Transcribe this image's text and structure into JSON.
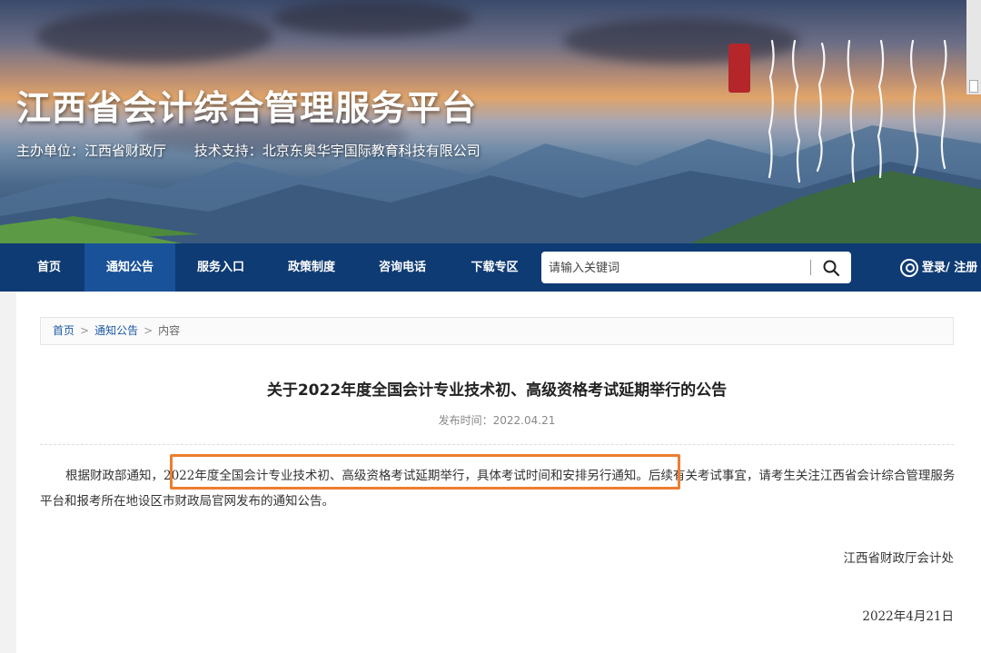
{
  "banner": {
    "title": "江西省会计综合管理服务平台",
    "host": "主办单位：江西省财政厅",
    "support": "技术支持：北京东奥华宇国际教育科技有限公司"
  },
  "nav": {
    "items": [
      {
        "label": "首页"
      },
      {
        "label": "通知公告"
      },
      {
        "label": "服务入口"
      },
      {
        "label": "政策制度"
      },
      {
        "label": "咨询电话"
      },
      {
        "label": "下载专区"
      }
    ],
    "active": "通知公告",
    "search_placeholder": "请输入关键词",
    "login_label": "登录/ 注册"
  },
  "breadcrumb": {
    "home": "首页",
    "notices": "通知公告",
    "current": "内容",
    "separator": ">"
  },
  "article": {
    "title": "关于2022年度全国会计专业技术初、高级资格考试延期举行的公告",
    "publish_time": "发布时间：2022.04.21",
    "body_lead": "根据财政部通知，",
    "body_highlight": "2022年度全国会计专业技术初、高级资格考试延期举行，具体考试时间和安排另行通知。",
    "body_rest": "后续有关考试事宜，请考生关注江西省会计综合管理服务平台和报考所在地设区市财政局官网发布的通知公告。",
    "signoff": "江西省财政厅会计处",
    "date": "2022年4月21日"
  },
  "colors": {
    "nav_bg": "#0e3b73",
    "nav_active": "#1a5299",
    "link": "#1e5aa6",
    "highlight_border": "#ee7d31"
  }
}
